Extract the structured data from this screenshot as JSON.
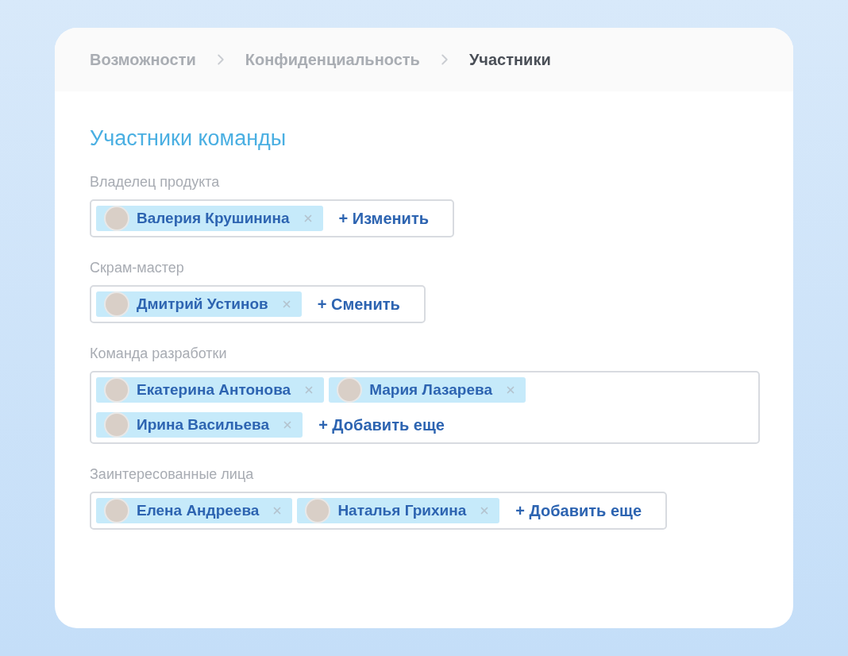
{
  "breadcrumbs": [
    {
      "label": "Возможности",
      "selected": false
    },
    {
      "label": "Конфиденциальность",
      "selected": false
    },
    {
      "label": "Участники",
      "selected": true
    }
  ],
  "title": "Участники команды",
  "groups": [
    {
      "label": "Владелец продукта",
      "members": [
        {
          "name": "Валерия Крушинина"
        }
      ],
      "action": "+ Изменить"
    },
    {
      "label": "Скрам-мастер",
      "members": [
        {
          "name": "Дмитрий Устинов"
        }
      ],
      "action": "+ Сменить"
    },
    {
      "label": "Команда разработки",
      "members": [
        {
          "name": "Екатерина Антонова"
        },
        {
          "name": "Мария Лазарева"
        },
        {
          "name": "Ирина Васильева"
        }
      ],
      "action": "+ Добавить еще"
    },
    {
      "label": "Заинтересованные лица",
      "members": [
        {
          "name": "Елена Андреева"
        },
        {
          "name": "Наталья Грихина"
        }
      ],
      "action": "+ Добавить еще"
    }
  ]
}
